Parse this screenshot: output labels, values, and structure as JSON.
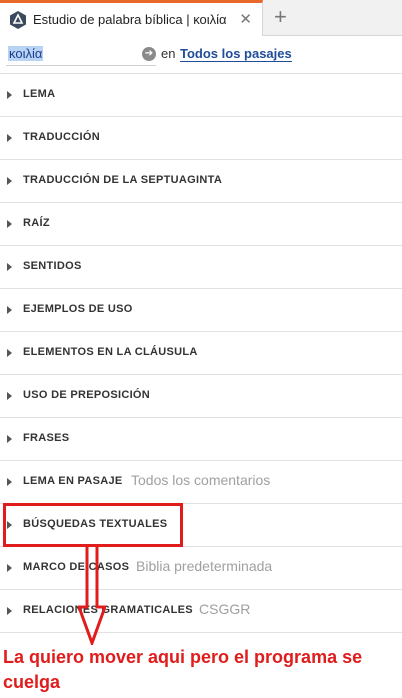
{
  "tab": {
    "title": "Estudio de palabra bíblica | κοιλία",
    "close": "✕",
    "add": "+"
  },
  "search": {
    "value": "κοιλία",
    "go": "➔",
    "en": "en",
    "scope": "Todos los pasajes"
  },
  "sections": [
    {
      "label": "LEMA",
      "sub": ""
    },
    {
      "label": "TRADUCCIÓN",
      "sub": ""
    },
    {
      "label": "TRADUCCIÓN DE LA SEPTUAGINTA",
      "sub": ""
    },
    {
      "label": "RAÍZ",
      "sub": ""
    },
    {
      "label": "SENTIDOS",
      "sub": ""
    },
    {
      "label": "EJEMPLOS DE USO",
      "sub": ""
    },
    {
      "label": "ELEMENTOS EN LA CLÁUSULA",
      "sub": ""
    },
    {
      "label": "USO DE PREPOSICIÓN",
      "sub": ""
    },
    {
      "label": "FRASES",
      "sub": ""
    },
    {
      "label": "LEMA EN PASAJE",
      "sub": "Todos los comentarios"
    },
    {
      "label": "BÚSQUEDAS TEXTUALES",
      "sub": ""
    },
    {
      "label": "MARCO DE CASOS",
      "sub": "Biblia predeterminada"
    },
    {
      "label": "RELACIONES GRAMATICALES",
      "sub": "CSGGR"
    }
  ],
  "annotation": {
    "note": "La quiero mover aqui pero el programa se cuelga",
    "color": "#e01c1c"
  }
}
